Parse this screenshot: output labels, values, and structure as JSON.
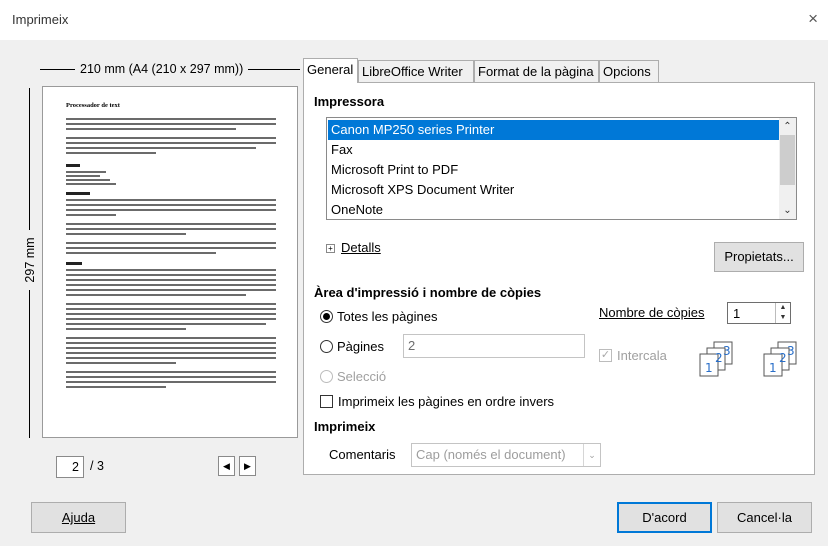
{
  "window": {
    "title": "Imprimeix",
    "close_icon": "×"
  },
  "preview": {
    "width_label": "210 mm (A4 (210 x 297 mm))",
    "height_label": "297 mm",
    "page_heading": "Processador de text",
    "current_page": "2",
    "total_pages": "/ 3"
  },
  "tabs": [
    {
      "label": "General"
    },
    {
      "label": "LibreOffice Writer"
    },
    {
      "label": "Format de la pàgina"
    },
    {
      "label": "Opcions"
    }
  ],
  "printer": {
    "section_label": "Impressora",
    "items": [
      "Canon MP250 series Printer",
      "Fax",
      "Microsoft Print to PDF",
      "Microsoft XPS Document Writer",
      "OneNote"
    ],
    "details_label": "Detalls",
    "properties_button": "Propietats..."
  },
  "range": {
    "section_label": "Àrea d'impressió i nombre de còpies",
    "all_pages": "Totes les pàgines",
    "pages": "Pàgines",
    "pages_value": "2",
    "selection": "Selecció",
    "reverse": "Imprimeix les pàgines en ordre invers",
    "copies_label": "Nombre de còpies",
    "copies_value": "1",
    "collate": "Intercala"
  },
  "print": {
    "section_label": "Imprimeix",
    "comments_label": "Comentaris",
    "comments_value": "Cap (només el document)"
  },
  "buttons": {
    "help": "Ajuda",
    "ok": "D'acord",
    "cancel": "Cancel·la"
  }
}
